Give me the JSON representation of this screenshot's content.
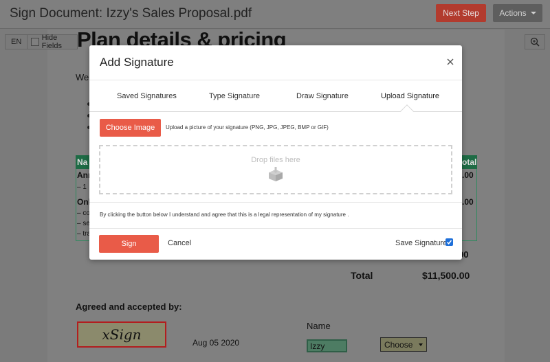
{
  "header": {
    "title": "Sign Document: Izzy's Sales Proposal.pdf",
    "next_step_label": "Next Step",
    "actions_label": "Actions"
  },
  "toolbar": {
    "lang_label": "EN",
    "hide_fields_label": "Hide Fields"
  },
  "document": {
    "heading": "Plan details & pricing",
    "intro_fragment": "We",
    "table_fragments": {
      "head_left": "Na",
      "head_right": "otal",
      "row1_left": "Anı",
      "row1_right": ".00",
      "row1_sub": "– 1",
      "row2_left": "Onl",
      "row2_right": ".00",
      "row2_sub1": "– co",
      "row2_sub2": "– se",
      "row2_sub3": "– tra"
    },
    "subtotal_fragment": "00",
    "total_label": "Total",
    "total_value": "$11,500.00",
    "agreed_label": "Agreed and accepted by:",
    "signature_logo": "xSign",
    "sign_date": "Aug 05 2020",
    "name_label": "Name",
    "name_value": "Izzy",
    "choose_value": "Choose"
  },
  "modal": {
    "title": "Add Signature",
    "tabs": [
      {
        "label": "Saved Signatures",
        "active": false
      },
      {
        "label": "Type Signature",
        "active": false
      },
      {
        "label": "Draw Signature",
        "active": false
      },
      {
        "label": "Upload Signature",
        "active": true
      }
    ],
    "choose_image_label": "Choose Image",
    "upload_hint": "Upload a picture of your signature (PNG, JPG, JPEG, BMP or GIF)",
    "drop_text": "Drop files here",
    "legal_text": "By clicking the button below I understand and agree that this is a legal representation of my signature .",
    "sign_label": "Sign",
    "cancel_label": "Cancel",
    "save_signature_label": "Save Signature",
    "save_signature_checked": true
  },
  "colors": {
    "accent": "#e95b48",
    "next_step_dimmed": "#b23b2e",
    "checkbox": "#1e6fd9"
  }
}
